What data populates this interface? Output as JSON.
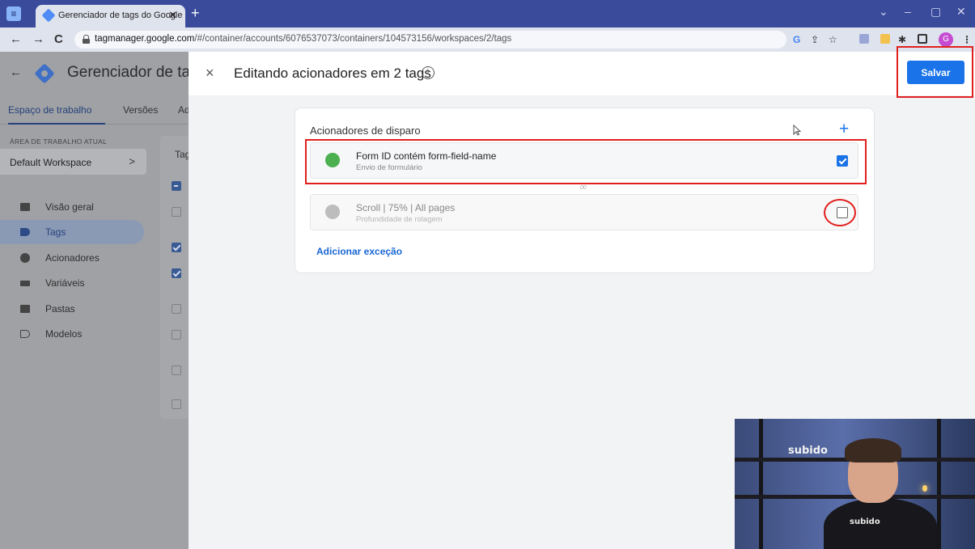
{
  "browser": {
    "tab_title": "Gerenciador de tags do Google",
    "tab_close": "✕",
    "new_tab": "+",
    "url_host": "tagmanager.google.com",
    "url_path": "/#/container/accounts/6076537073/containers/104573156/workspaces/2/tags",
    "win_minimize_chevron": "⌄",
    "win_min": "–",
    "win_max": "▢",
    "win_close": "✕",
    "back": "←",
    "forward": "→",
    "reload": "C",
    "toolbar_g": "G",
    "profile_initial": "G"
  },
  "gtm": {
    "app_title": "Gerenciador de tags",
    "workspace_tabs": [
      "Espaço de trabalho",
      "Versões",
      "Ad"
    ],
    "current_workspace_label": "ÁREA DE TRABALHO ATUAL",
    "workspace_name": "Default Workspace",
    "workspace_chevron": ">",
    "nav": [
      {
        "label": "Visão geral",
        "icon": "folder-icon"
      },
      {
        "label": "Tags",
        "icon": "tag-icon"
      },
      {
        "label": "Acionadores",
        "icon": "trigger-icon"
      },
      {
        "label": "Variáveis",
        "icon": "variables-icon"
      },
      {
        "label": "Pastas",
        "icon": "folder-icon"
      },
      {
        "label": "Modelos",
        "icon": "template-icon"
      }
    ],
    "tags_card_label": "Tag"
  },
  "editor": {
    "title": "Editando acionadores em 2 tags",
    "info_glyph": "i",
    "close_glyph": "×",
    "save_label": "Salvar",
    "section_heading": "Acionadores de disparo",
    "add_glyph": "+",
    "triggers": [
      {
        "name": "Form ID contém form-field-name",
        "type": "Envio de formulário",
        "checked": true,
        "color": "#4caf50"
      },
      {
        "name": "Scroll | 75% | All pages",
        "type": "Profundidade de rolagem",
        "checked": false,
        "color": "#bdbdbd"
      }
    ],
    "separator_mark": "00",
    "add_exception": "Adicionar exceção"
  },
  "webcam": {
    "brand": "subido",
    "shirt": "subido"
  },
  "colors": {
    "accent": "#1a73e8",
    "highlight": "#e0201e",
    "tabstrip": "#3a4b9c"
  }
}
